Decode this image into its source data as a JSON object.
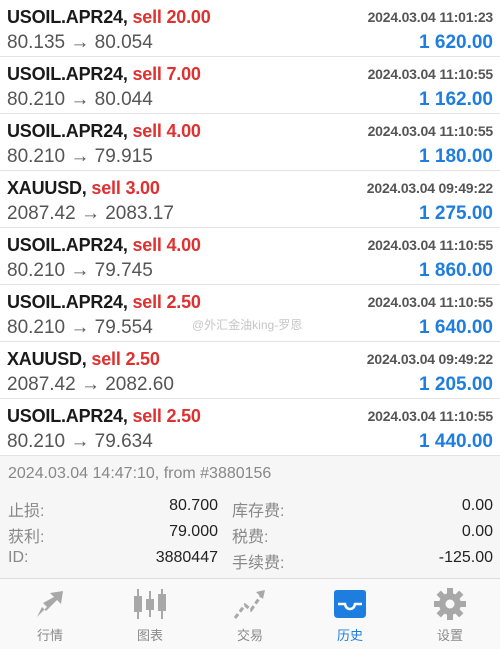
{
  "trades": [
    {
      "symbol": "USOIL.APR24,",
      "side": "sell 20.00",
      "time": "2024.03.04 11:01:23",
      "prices": "80.135 → 80.054",
      "profit": "1 620.00"
    },
    {
      "symbol": "USOIL.APR24,",
      "side": "sell 7.00",
      "time": "2024.03.04 11:10:55",
      "prices": "80.210 → 80.044",
      "profit": "1 162.00"
    },
    {
      "symbol": "USOIL.APR24,",
      "side": "sell 4.00",
      "time": "2024.03.04 11:10:55",
      "prices": "80.210 → 79.915",
      "profit": "1 180.00"
    },
    {
      "symbol": "XAUUSD,",
      "side": "sell 3.00",
      "time": "2024.03.04 09:49:22",
      "prices": "2087.42 → 2083.17",
      "profit": "1 275.00"
    },
    {
      "symbol": "USOIL.APR24,",
      "side": "sell 4.00",
      "time": "2024.03.04 11:10:55",
      "prices": "80.210 → 79.745",
      "profit": "1 860.00"
    },
    {
      "symbol": "USOIL.APR24,",
      "side": "sell 2.50",
      "time": "2024.03.04 11:10:55",
      "prices": "80.210 → 79.554",
      "profit": "1 640.00"
    },
    {
      "symbol": "XAUUSD,",
      "side": "sell 2.50",
      "time": "2024.03.04 09:49:22",
      "prices": "2087.42 → 2082.60",
      "profit": "1 205.00"
    },
    {
      "symbol": "USOIL.APR24,",
      "side": "sell 2.50",
      "time": "2024.03.04 11:10:55",
      "prices": "80.210 → 79.634",
      "profit": "1 440.00"
    }
  ],
  "detail": {
    "header": "2024.03.04 14:47:10, from #3880156",
    "stop_loss_label": "止损:",
    "stop_loss_value": "80.700",
    "take_profit_label": "获利:",
    "take_profit_value": "79.000",
    "id_label": "ID:",
    "id_value": "3880447",
    "swap_label": "库存费:",
    "swap_value": "0.00",
    "tax_label": "税费:",
    "tax_value": "0.00",
    "commission_label": "手续费:",
    "commission_value": "-125.00"
  },
  "watermark": "@外汇金油king-罗恩",
  "tabs": [
    {
      "label": "行情",
      "icon": "quotes-icon"
    },
    {
      "label": "图表",
      "icon": "chart-icon"
    },
    {
      "label": "交易",
      "icon": "trade-icon"
    },
    {
      "label": "历史",
      "icon": "history-icon",
      "active": true
    },
    {
      "label": "设置",
      "icon": "settings-icon"
    }
  ],
  "colors": {
    "sell": "#e03030",
    "profit": "#1e7ee0",
    "active_tab": "#1e7ee0"
  }
}
